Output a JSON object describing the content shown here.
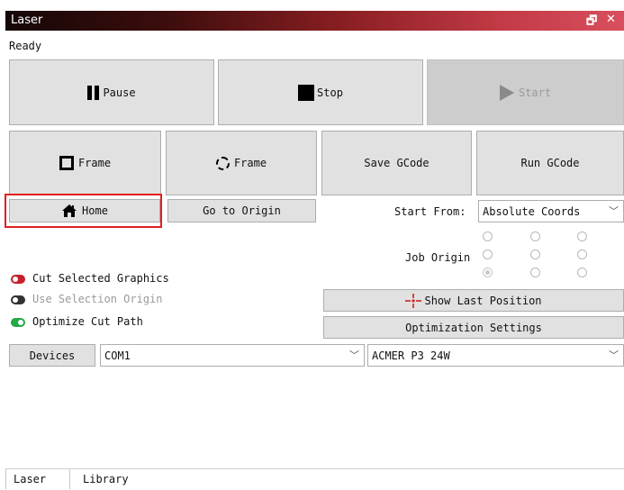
{
  "window": {
    "title": "Laser",
    "float_btn": "🗗",
    "close_btn": "✕"
  },
  "status": "Ready",
  "controls": {
    "pause": "Pause",
    "stop": "Stop",
    "start": "Start",
    "frame_rect": "Frame",
    "frame_circle": "Frame",
    "save_gcode": "Save GCode",
    "run_gcode": "Run GCode",
    "home": "Home",
    "go_to_origin": "Go to Origin"
  },
  "start_from": {
    "label": "Start From:",
    "value": "Absolute Coords"
  },
  "job_origin": {
    "label": "Job Origin",
    "selected": "bottom-left"
  },
  "options": {
    "cut_selected": "Cut Selected Graphics",
    "use_selection_origin": "Use Selection Origin",
    "optimize_cut_path": "Optimize Cut Path"
  },
  "buttons": {
    "show_last_position": "Show Last Position",
    "optimization_settings": "Optimization Settings",
    "devices": "Devices"
  },
  "port": "COM1",
  "device": "ACMER P3 24W",
  "tabs": [
    "Laser",
    "Library"
  ],
  "colors": {
    "toggle_red": "#c8202a",
    "toggle_green": "#22a845",
    "toggle_dark": "#333333",
    "highlight": "#e02020"
  }
}
